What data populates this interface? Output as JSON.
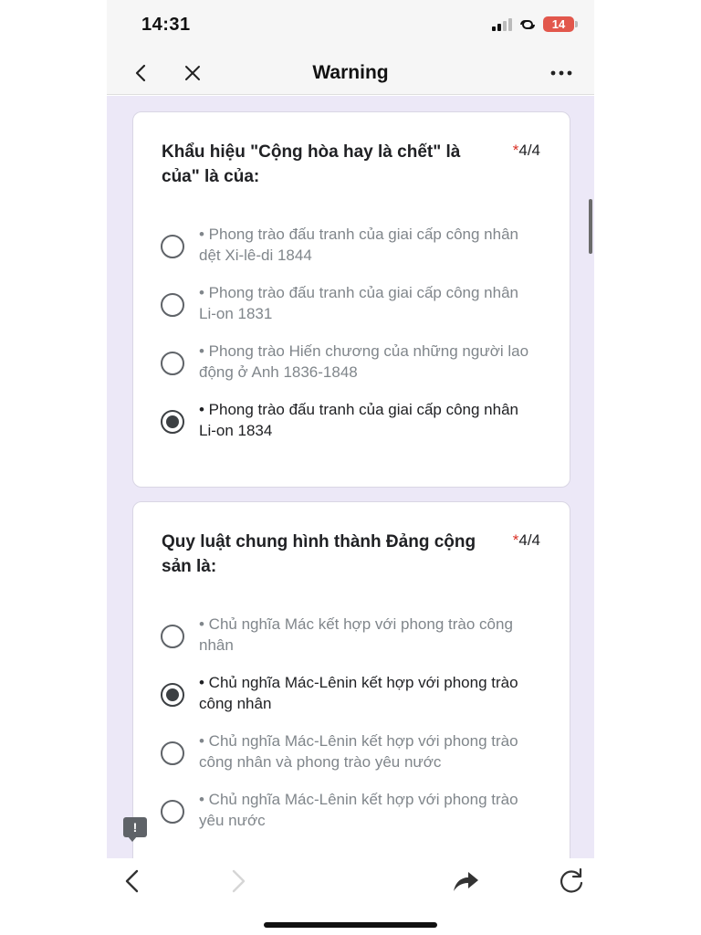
{
  "status_bar": {
    "time": "14:31",
    "battery": "14",
    "icons": [
      "signal-icon",
      "link-icon",
      "battery-icon"
    ]
  },
  "nav": {
    "title": "Warning",
    "back_icon": "chevron-left-icon",
    "close_icon": "close-icon",
    "more_icon": "more-horizontal-icon"
  },
  "questions": [
    {
      "title": "Khẩu hiệu \"Cộng hòa hay là chết\" là của\" là của:",
      "required_mark": "*",
      "score": "4/4",
      "options": [
        {
          "text": "• Phong trào đấu tranh của giai cấp công nhân dệt Xi-lê-di 1844",
          "selected": false
        },
        {
          "text": "• Phong trào đấu tranh của giai cấp công nhân Li-on 1831",
          "selected": false
        },
        {
          "text": "• Phong trào Hiến chương của những người lao động ở Anh 1836-1848",
          "selected": false
        },
        {
          "text": "• Phong trào đấu tranh của giai cấp công nhân Li-on 1834",
          "selected": true
        }
      ]
    },
    {
      "title": "Quy luật chung hình thành Đảng cộng sản là:",
      "required_mark": "*",
      "score": "4/4",
      "options": [
        {
          "text": "• Chủ nghĩa Mác kết hợp với phong trào công nhân",
          "selected": false
        },
        {
          "text": "• Chủ nghĩa Mác-Lênin kết hợp với phong trào công nhân",
          "selected": true
        },
        {
          "text": "• Chủ nghĩa Mác-Lênin kết hợp với phong trào công nhân và phong trào yêu nước",
          "selected": false
        },
        {
          "text": "• Chủ nghĩa Mác-Lênin kết hợp với phong trào yêu nước",
          "selected": false
        }
      ]
    }
  ],
  "feedback": {
    "icon": "feedback-icon",
    "glyph": "!"
  },
  "toolbar": {
    "icons": [
      "back-arrow-icon",
      "forward-arrow-icon",
      "share-icon",
      "refresh-icon"
    ]
  },
  "colors": {
    "content_background": "#ece8f7",
    "required_star": "#d93025",
    "battery": "#e2574c"
  }
}
